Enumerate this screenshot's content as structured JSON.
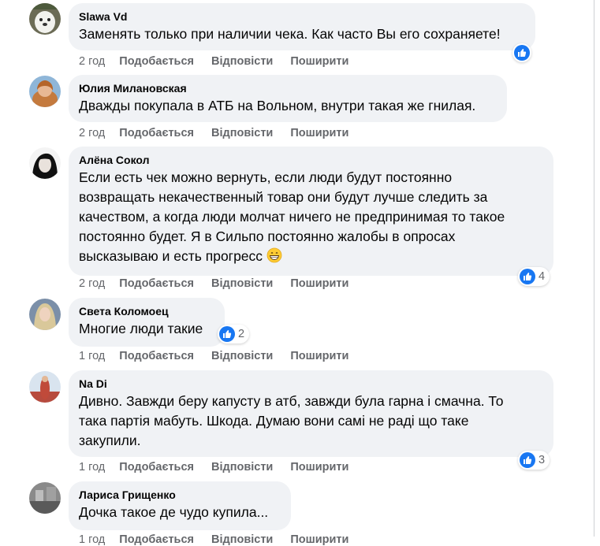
{
  "labels": {
    "like": "Подобається",
    "reply": "Відповісти",
    "share": "Поширити"
  },
  "comments": [
    {
      "author": "Slawa Vd",
      "text": "Заменять только при наличии чека. Как часто Вы его сохраняете!",
      "time": "2 год",
      "reactions": ""
    },
    {
      "author": "Юлия Милановская",
      "text": "Дважды покупала в АТБ на Вольном, внутри такая же гнилая.",
      "time": "2 год",
      "reactions": ""
    },
    {
      "author": "Алёна Сокол",
      "text_lines": [
        "Если есть чек можно вернуть, если люди будут постоянно",
        "возвращать некачественный товар они будут лучше следить за",
        "качеством, а когда люди молчат ничего не предпринимая то такое",
        "постоянно будет. Я в Сильпо постоянно жалобы в опросах",
        "высказываю и есть прогресс"
      ],
      "emoji": "grinning-face-emoji",
      "time": "2 год",
      "reactions": "4"
    },
    {
      "author": "Света Коломоец",
      "text": "Многие люди такие",
      "time": "1 год",
      "reactions": "2"
    },
    {
      "author": "Na Di",
      "text_lines": [
        "Дивно. Завжди беру капусту в атб, завжди була гарна і смачна. То",
        "така партія мабуть. Шкода. Думаю вони самі не раді що таке",
        "закупили."
      ],
      "time": "1 год",
      "reactions": "3"
    },
    {
      "author": "Лариса Грищенко",
      "text": "Дочка такое де чудо купила...",
      "time": "1 год",
      "reactions": ""
    }
  ],
  "colors": {
    "like_blue": "#1877f2",
    "bubble": "#f0f2f5",
    "meta": "#65676b"
  }
}
